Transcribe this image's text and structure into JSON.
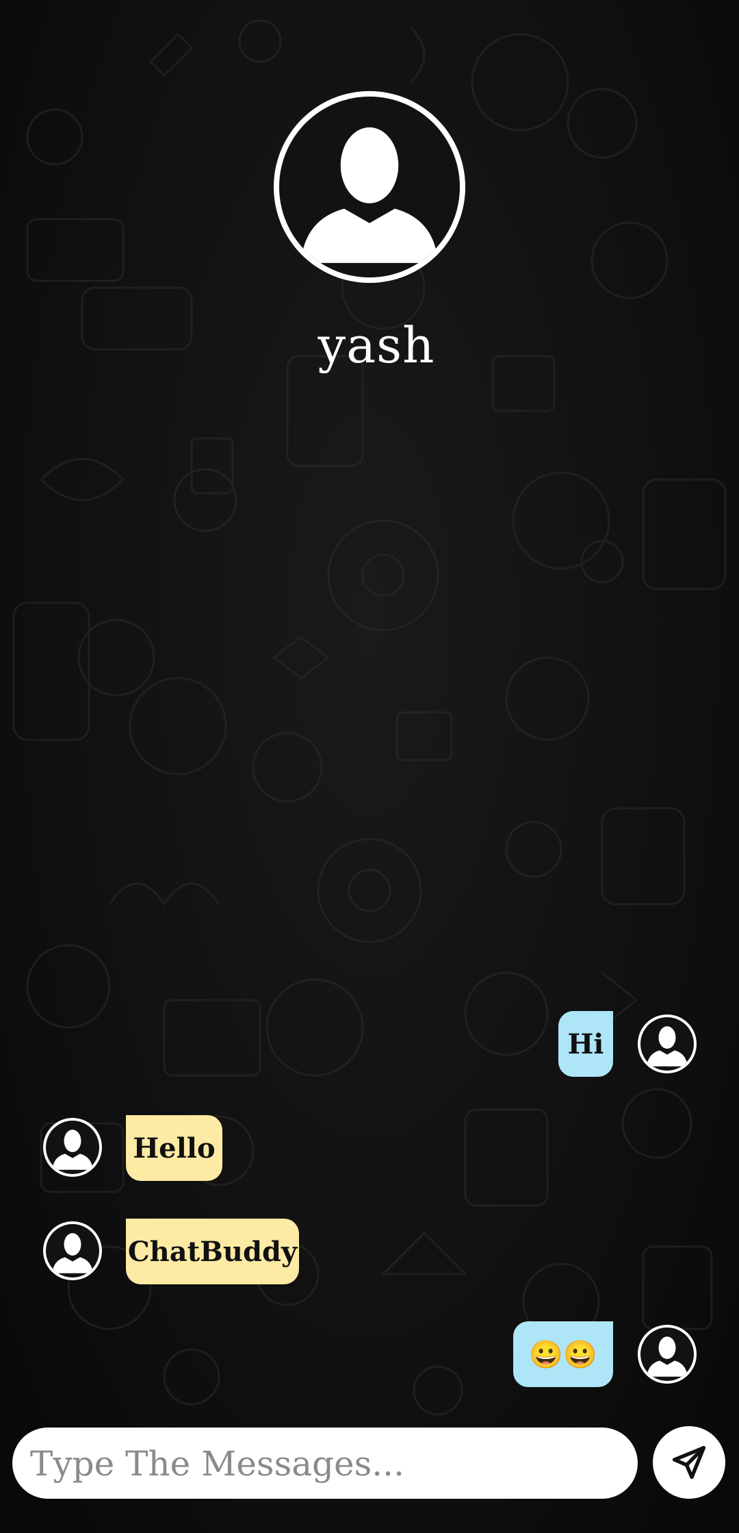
{
  "contact": {
    "name": "yash",
    "avatar_icon": "user-silhouette-icon"
  },
  "messages": [
    {
      "direction": "sent",
      "text": "Hi"
    },
    {
      "direction": "received",
      "text": "Hello"
    },
    {
      "direction": "received",
      "text": "ChatBuddy"
    },
    {
      "direction": "sent",
      "text": "😀😀"
    }
  ],
  "composer": {
    "placeholder": "Type The Messages...",
    "value": "",
    "send_icon": "send-arrow-icon"
  },
  "colors": {
    "sent_bubble": "#aee6f8",
    "received_bubble": "#fdeaa4",
    "background": "#101010"
  }
}
